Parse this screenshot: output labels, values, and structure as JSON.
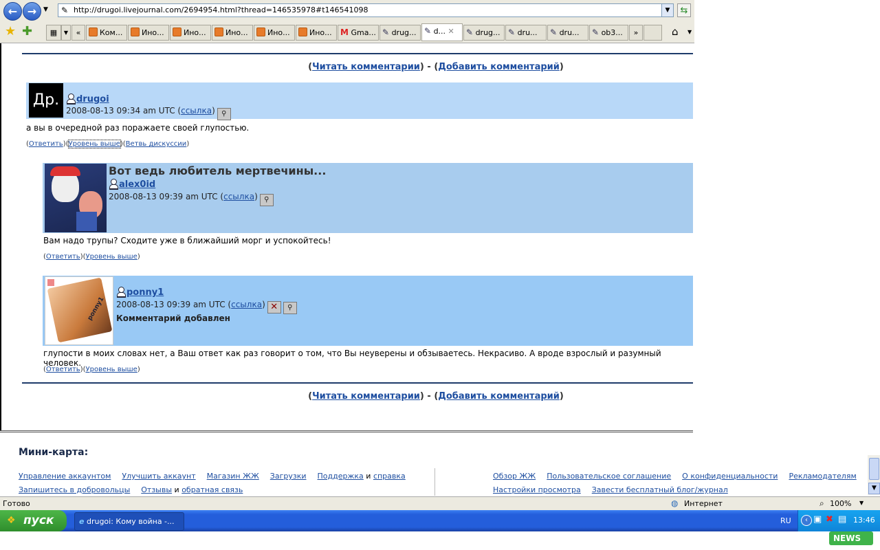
{
  "browser": {
    "url": "http://drugoi.livejournal.com/2694954.html?thread=146535978#t146541098",
    "tabs": [
      {
        "label": "Ком..."
      },
      {
        "label": "Ино..."
      },
      {
        "label": "Ино..."
      },
      {
        "label": "Ино..."
      },
      {
        "label": "Ино..."
      },
      {
        "label": "Ино..."
      },
      {
        "label": "Gma..."
      },
      {
        "label": "drug..."
      },
      {
        "label": "d..."
      },
      {
        "label": "drug..."
      },
      {
        "label": "dru..."
      },
      {
        "label": "dru..."
      },
      {
        "label": "ob3..."
      }
    ],
    "tab_close": "✕",
    "tab_scroll_left": "«",
    "tab_scroll_right": "»"
  },
  "page": {
    "read_comments": "Читать комментарии",
    "add_comment": "Добавить комментарий",
    "sep": " - ",
    "lp": "(",
    "rp": ")",
    "comments": [
      {
        "avatar_text": "Др.",
        "user": "drugoi",
        "date": "2008-08-13 09:34 am UTC",
        "link": "ссылка",
        "body": "а вы в очередной раз поражаете своей глупостью.",
        "actions": [
          "Ответить",
          "Уровень выше",
          "Ветвь дискуссии"
        ]
      },
      {
        "title": "Вот ведь любитель мертвечины...",
        "user": "alex0id",
        "date": "2008-08-13 09:39 am UTC",
        "link": "ссылка",
        "body": "Вам надо трупы? Сходите уже в ближайший морг и успокойтесь!",
        "actions": [
          "Ответить",
          "Уровень выше"
        ]
      },
      {
        "user": "ponny1",
        "date": "2008-08-13 09:39 am UTC",
        "link": "ссылка",
        "added_note": "Комментарий добавлен",
        "avatar_caption": "ponny1",
        "body": "глупости в моих словах нет, а Ваш ответ как раз говорит о том, что Вы неуверены и обзываетесь. Некрасиво. А вроде взрослый и разумный человек.",
        "actions": [
          "Ответить",
          "Уровень выше"
        ]
      }
    ]
  },
  "minimap": {
    "title": "Мини-карта:",
    "left_row1": [
      "Управление аккаунтом",
      "Улучшить аккаунт",
      "Магазин ЖЖ",
      "Загрузки"
    ],
    "support_a": "Поддержка",
    "support_and": " и ",
    "support_b": "справка",
    "volunteer": "Запишитесь в добровольцы",
    "feedback_a": "Отзывы",
    "feedback_and": " и ",
    "feedback_b": "обратная связь",
    "right_row1": [
      "Обзор ЖЖ",
      "Пользовательское соглашение",
      "О конфиденциальности",
      "Рекламодателям"
    ],
    "right_row2": [
      "Настройки просмотра",
      "Завести бесплатный блог/журнал"
    ]
  },
  "status": {
    "ready": "Готово",
    "zone": "Интернет",
    "zoom": "100%"
  },
  "taskbar": {
    "start": "пуск",
    "task": "drugoi: Кому война -...",
    "lang": "RU",
    "time": "13:46",
    "news": "NEWS"
  },
  "colors": {
    "comment1_bg": "#b8d8f8",
    "comment2_bg": "#a8ccee",
    "comment3_bg": "#99c9f5",
    "link": "#1e4ea0"
  }
}
